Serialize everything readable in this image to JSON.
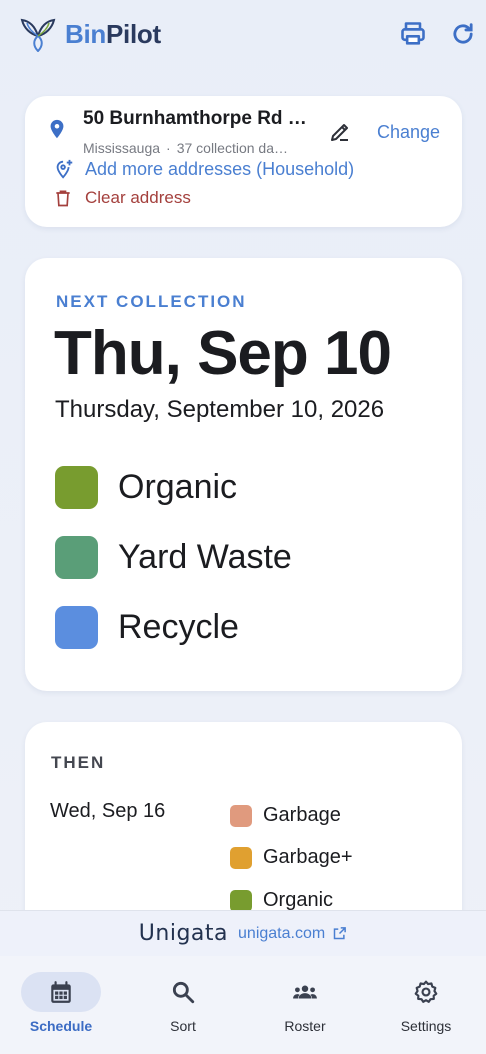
{
  "app": {
    "brand_part1": "Bin",
    "brand_part2": "Pilot"
  },
  "header": {
    "icons": [
      "print-icon",
      "refresh-icon"
    ]
  },
  "address": {
    "title": "50 Burnhamthorpe Rd …",
    "city": "Mississauga",
    "separator": "·",
    "count": "37 collection da…",
    "change_label": "Change",
    "add_more_label": "Add more addresses (Household)",
    "clear_label": "Clear address"
  },
  "next": {
    "label": "NEXT COLLECTION",
    "date_short": "Thu, Sep 10",
    "date_full": "Thursday, September 10, 2026",
    "bins": [
      {
        "name": "Organic",
        "color": "#789c2f"
      },
      {
        "name": "Yard Waste",
        "color": "#5a9e78"
      },
      {
        "name": "Recycle",
        "color": "#5b8edf"
      }
    ]
  },
  "then": {
    "label": "THEN",
    "date": "Wed, Sep 16",
    "bins": [
      {
        "name": "Garbage",
        "color": "#e09a7e"
      },
      {
        "name": "Garbage+",
        "color": "#e0a030"
      },
      {
        "name": "Organic",
        "color": "#789c2f"
      }
    ]
  },
  "promo": {
    "logo_text": "Unigata",
    "link": "unigata.com"
  },
  "nav": {
    "items": [
      {
        "label": "Schedule",
        "icon": "calendar-icon",
        "active": true
      },
      {
        "label": "Sort",
        "icon": "search-icon",
        "active": false
      },
      {
        "label": "Roster",
        "icon": "group-icon",
        "active": false
      },
      {
        "label": "Settings",
        "icon": "gear-icon",
        "active": false
      }
    ]
  },
  "colors": {
    "accent": "#4a7fd1",
    "danger": "#a4403d",
    "brand_dark": "#2a3a5e"
  }
}
